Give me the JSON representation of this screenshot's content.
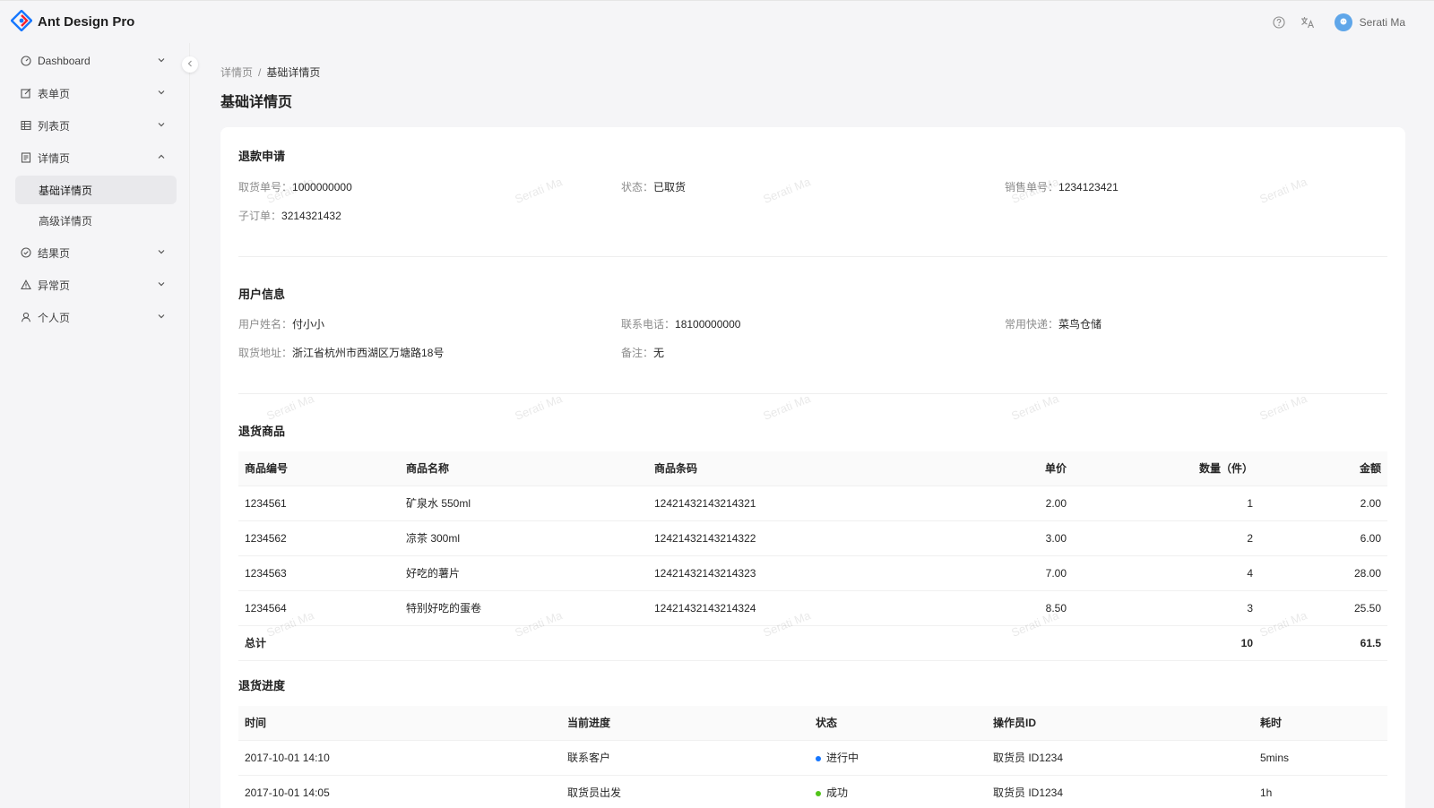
{
  "app": {
    "title": "Ant Design Pro"
  },
  "header": {
    "user_name": "Serati Ma",
    "help_icon": "question-circle-icon",
    "lang_icon": "translation-icon"
  },
  "sidebar": {
    "items": [
      {
        "label": "Dashboard",
        "icon": "dashboard-icon"
      },
      {
        "label": "表单页",
        "icon": "form-icon"
      },
      {
        "label": "列表页",
        "icon": "table-icon"
      },
      {
        "label": "详情页",
        "icon": "profile-icon"
      },
      {
        "label": "结果页",
        "icon": "check-circle-icon"
      },
      {
        "label": "异常页",
        "icon": "warning-icon"
      },
      {
        "label": "个人页",
        "icon": "user-icon"
      }
    ],
    "sub_items": [
      {
        "label": "基础详情页"
      },
      {
        "label": "高级详情页"
      }
    ]
  },
  "breadcrumb": {
    "parent": "详情页",
    "current": "基础详情页",
    "separator": "/"
  },
  "page": {
    "title": "基础详情页"
  },
  "refund": {
    "title": "退款申请",
    "fields": [
      {
        "key": "取货单号：",
        "value": "1000000000"
      },
      {
        "key": "状态：",
        "value": "已取货"
      },
      {
        "key": "销售单号：",
        "value": "1234123421"
      },
      {
        "key": "子订单：",
        "value": "3214321432"
      }
    ]
  },
  "user_info": {
    "title": "用户信息",
    "fields": [
      {
        "key": "用户姓名：",
        "value": "付小小"
      },
      {
        "key": "联系电话：",
        "value": "18100000000"
      },
      {
        "key": "常用快递：",
        "value": "菜鸟仓储"
      },
      {
        "key": "取货地址：",
        "value": "浙江省杭州市西湖区万塘路18号"
      },
      {
        "key": "备注：",
        "value": "无"
      }
    ]
  },
  "goods": {
    "title": "退货商品",
    "columns": [
      "商品编号",
      "商品名称",
      "商品条码",
      "单价",
      "数量（件）",
      "金额"
    ],
    "rows": [
      [
        "1234561",
        "矿泉水 550ml",
        "12421432143214321",
        "2.00",
        "1",
        "2.00"
      ],
      [
        "1234562",
        "凉茶 300ml",
        "12421432143214322",
        "3.00",
        "2",
        "6.00"
      ],
      [
        "1234563",
        "好吃的薯片",
        "12421432143214323",
        "7.00",
        "4",
        "28.00"
      ],
      [
        "1234564",
        "特别好吃的蛋卷",
        "12421432143214324",
        "8.50",
        "3",
        "25.50"
      ]
    ],
    "total": {
      "label": "总计",
      "count": "10",
      "amount": "61.5"
    }
  },
  "progress": {
    "title": "退货进度",
    "columns": [
      "时间",
      "当前进度",
      "状态",
      "操作员ID",
      "耗时"
    ],
    "rows": [
      {
        "time": "2017-10-01 14:10",
        "step": "联系客户",
        "status": "进行中",
        "status_color": "#1677ff",
        "operator": "取货员 ID1234",
        "duration": "5mins"
      },
      {
        "time": "2017-10-01 14:05",
        "step": "取货员出发",
        "status": "成功",
        "status_color": "#52c41a",
        "operator": "取货员 ID1234",
        "duration": "1h"
      }
    ]
  },
  "watermark": {
    "text": "Serati Ma"
  },
  "colors": {
    "brand": "#1677ff",
    "success": "#52c41a",
    "logo_red": "#f5222d"
  }
}
